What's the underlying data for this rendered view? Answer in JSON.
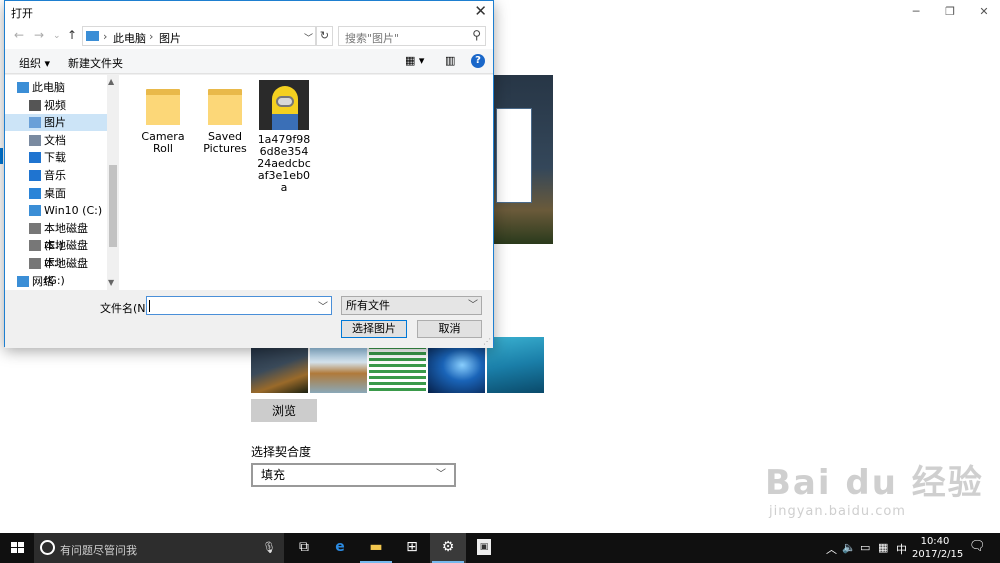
{
  "settings": {
    "browse_label": "浏览",
    "fit_label": "选择契合度",
    "fit_value": "填充",
    "thumbnails": [
      "night-sky-wallpaper",
      "beach-rocks-wallpaper",
      "green-list-wallpaper",
      "windows-blue-wallpaper",
      "underwater-wallpaper"
    ]
  },
  "dialog": {
    "title": "打开",
    "breadcrumb": [
      "此电脑",
      "图片"
    ],
    "search_placeholder": "搜索\"图片\"",
    "toolbar": {
      "organize": "组织 ▾",
      "new_folder": "新建文件夹",
      "help": "?"
    },
    "nav_items": [
      {
        "label": "此电脑",
        "icon": "computer-icon",
        "color": "#3b8ed6"
      },
      {
        "label": "视频",
        "icon": "video-icon",
        "color": "#555555"
      },
      {
        "label": "图片",
        "icon": "pictures-icon",
        "color": "#6aa0d8",
        "selected": true
      },
      {
        "label": "文档",
        "icon": "documents-icon",
        "color": "#7a8aa0"
      },
      {
        "label": "下载",
        "icon": "download-icon",
        "color": "#1f74d0"
      },
      {
        "label": "音乐",
        "icon": "music-icon",
        "color": "#1f74d0"
      },
      {
        "label": "桌面",
        "icon": "desktop-icon",
        "color": "#2a84d8"
      },
      {
        "label": "Win10 (C:)",
        "icon": "drive-c-icon",
        "color": "#3b8ed6"
      },
      {
        "label": "本地磁盘 (E:)",
        "icon": "drive-icon",
        "color": "#777777"
      },
      {
        "label": "本地磁盘 (F:)",
        "icon": "drive-icon",
        "color": "#777777"
      },
      {
        "label": "本地磁盘 (G:)",
        "icon": "drive-icon",
        "color": "#777777"
      },
      {
        "label": "网络",
        "icon": "network-icon",
        "color": "#3b8ed6"
      }
    ],
    "files": [
      {
        "name": "Camera Roll",
        "type": "folder"
      },
      {
        "name": "Saved Pictures",
        "type": "folder"
      },
      {
        "name": "1a479f986d8e35424aedcbcaf3e1eb0a",
        "type": "image"
      }
    ],
    "filename_label": "文件名(N):",
    "filename_value": "",
    "filetype_value": "所有文件",
    "open_button": "选择图片",
    "cancel_button": "取消"
  },
  "taskbar": {
    "search_text": "有问题尽管问我",
    "ime": "中",
    "time": "10:40",
    "date": "2017/2/15",
    "accent": "#76b9ed"
  },
  "watermark": {
    "main": "Bai du 经验",
    "sub": "jingyan.baidu.com"
  }
}
